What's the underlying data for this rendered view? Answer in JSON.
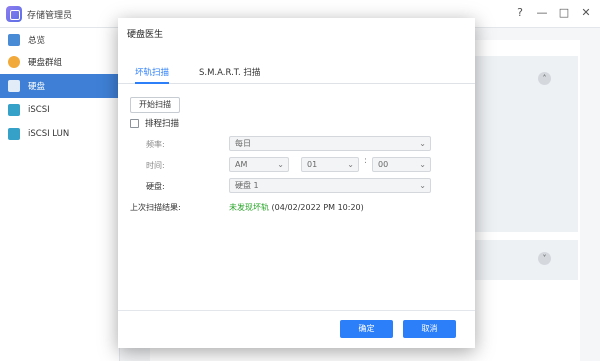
{
  "app": {
    "title": "存储管理员",
    "controls": [
      "?",
      "—",
      "□",
      "✕"
    ]
  },
  "sidebar": {
    "items": [
      {
        "label": "总览",
        "icon": "overview-icon",
        "color": "#4a8bd6",
        "active": false
      },
      {
        "label": "硬盘群组",
        "icon": "disk-group-icon",
        "color": "#f2a93b",
        "active": false
      },
      {
        "label": "硬盘",
        "icon": "hard-disk-icon",
        "color": "#ffffff",
        "active": true
      },
      {
        "label": "iSCSI",
        "icon": "iscsi-icon",
        "color": "#35a0c8",
        "active": false
      },
      {
        "label": "iSCSI LUN",
        "icon": "iscsi-lun-icon",
        "color": "#35a0c8",
        "active": false
      }
    ]
  },
  "dialog": {
    "title": "硬盘医生",
    "tabs": [
      {
        "label": "坏轨扫描",
        "active": true
      },
      {
        "label": "S.M.A.R.T. 扫描",
        "active": false
      }
    ],
    "start_scan_label": "开始扫描",
    "schedule_label": "排程扫描",
    "schedule_checked": false,
    "frequency": {
      "label": "频率:",
      "value": "每日"
    },
    "time": {
      "label": "时间:",
      "ampm": "AM",
      "hour": "01",
      "minute": "00"
    },
    "disk": {
      "label": "硬盘:",
      "value": "硬盘 1"
    },
    "last_result": {
      "label": "上次扫描结果:",
      "status": "未发现坏轨",
      "detail": " (04/02/2022 PM 10:20)"
    },
    "ok_label": "确定",
    "cancel_label": "取消"
  },
  "colors": {
    "accent": "#2d7ff9",
    "success": "#2aa52a",
    "sidebar_active": "#3f80d6"
  }
}
